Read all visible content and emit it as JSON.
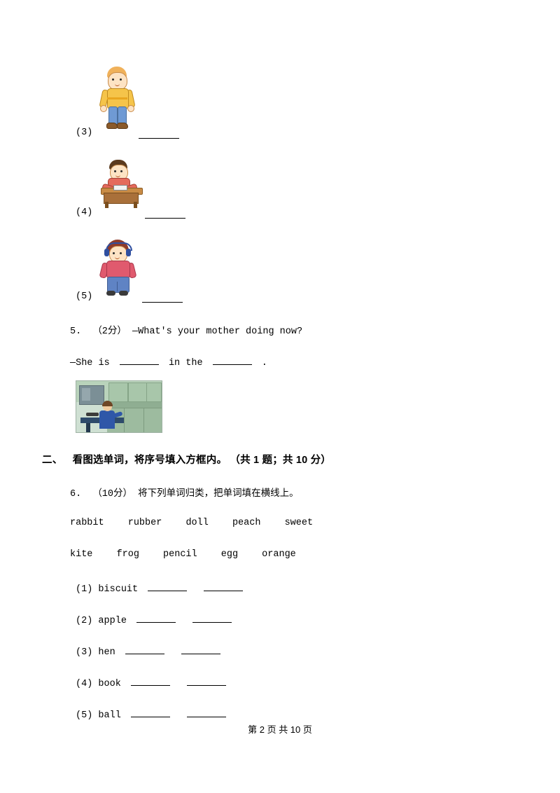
{
  "document": {
    "items": [
      {
        "num": "(3)"
      },
      {
        "num": "(4)"
      },
      {
        "num": "(5)"
      }
    ],
    "question5": {
      "number": "5.",
      "score": "（2分）",
      "prompt": "—What's your mother doing now?",
      "answer_prefix": "—She is",
      "answer_middle": "in the",
      "answer_suffix": "."
    },
    "section2": {
      "marker": "二、",
      "title": "看图选单词，将序号填入方框内。",
      "count": "（共 1 题；共 10 分）"
    },
    "question6": {
      "number": "6.",
      "score": "（10分）",
      "text": "将下列单词归类，把单词填在横线上。",
      "word_bank_row1": [
        "rabbit",
        "rubber",
        "doll",
        "peach",
        "sweet"
      ],
      "word_bank_row2": [
        "kite",
        "frog",
        "pencil",
        "egg",
        "orange"
      ],
      "sub_items": [
        {
          "num": "(1)",
          "word": "biscuit"
        },
        {
          "num": "(2)",
          "word": "apple"
        },
        {
          "num": "(3)",
          "word": "hen"
        },
        {
          "num": "(4)",
          "word": "book"
        },
        {
          "num": "(5)",
          "word": "ball"
        }
      ]
    },
    "footer": "第 2 页  共 10 页"
  }
}
